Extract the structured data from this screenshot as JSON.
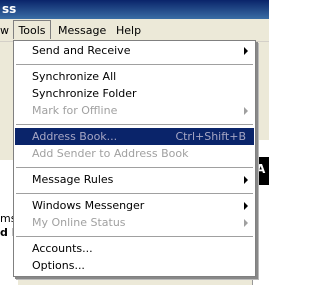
{
  "titlebar": {
    "text": "ss"
  },
  "menubar": {
    "items": [
      {
        "label": "w"
      },
      {
        "label": "Tools"
      },
      {
        "label": "Message"
      },
      {
        "label": "Help"
      }
    ]
  },
  "background": {
    "frag1": "ms",
    "frag2": "d I",
    "frag3": "A"
  },
  "menu": {
    "items": [
      {
        "label": "Send and Receive",
        "submenu": true,
        "enabled": true
      },
      {
        "label": "Synchronize All",
        "enabled": true
      },
      {
        "label": "Synchronize Folder",
        "enabled": true
      },
      {
        "label": "Mark for Offline",
        "submenu": true,
        "enabled": false
      },
      {
        "label": "Address Book...",
        "shortcut": "Ctrl+Shift+B",
        "enabled": false,
        "highlighted": true
      },
      {
        "label": "Add Sender to Address Book",
        "enabled": false
      },
      {
        "label": "Message Rules",
        "submenu": true,
        "enabled": true
      },
      {
        "label": "Windows Messenger",
        "submenu": true,
        "enabled": true
      },
      {
        "label": "My Online Status",
        "submenu": true,
        "enabled": false
      },
      {
        "label": "Accounts...",
        "enabled": true
      },
      {
        "label": "Options...",
        "enabled": true
      }
    ]
  }
}
